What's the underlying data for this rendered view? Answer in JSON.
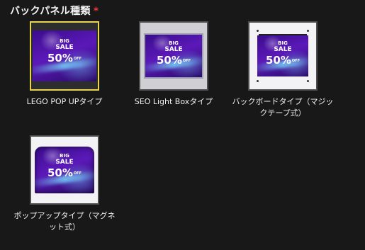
{
  "section": {
    "title": "バックパネル種類",
    "required_mark": "*"
  },
  "options": [
    {
      "label": "LEGO POP UPタイプ",
      "selected": true,
      "image": {
        "big": "BIG",
        "sale": "SALE",
        "percent": "50%",
        "off": "OFF"
      }
    },
    {
      "label": "SEO Light Boxタイプ",
      "selected": false,
      "image": {
        "big": "BIG",
        "sale": "SALE",
        "percent": "50%",
        "off": "OFF"
      }
    },
    {
      "label": "バックボードタイプ（マジックテープ式）",
      "selected": false,
      "image": {
        "big": "BIG",
        "sale": "SALE",
        "percent": "50%",
        "off": "OFF"
      }
    },
    {
      "label": "ポップアップタイプ（マグネット式）",
      "selected": false,
      "image": {
        "big": "BIG",
        "sale": "SALE",
        "percent": "50%",
        "off": "OFF"
      }
    }
  ],
  "colors": {
    "background": "#181818",
    "selected_border": "#e8d44d",
    "required": "#e53935"
  }
}
